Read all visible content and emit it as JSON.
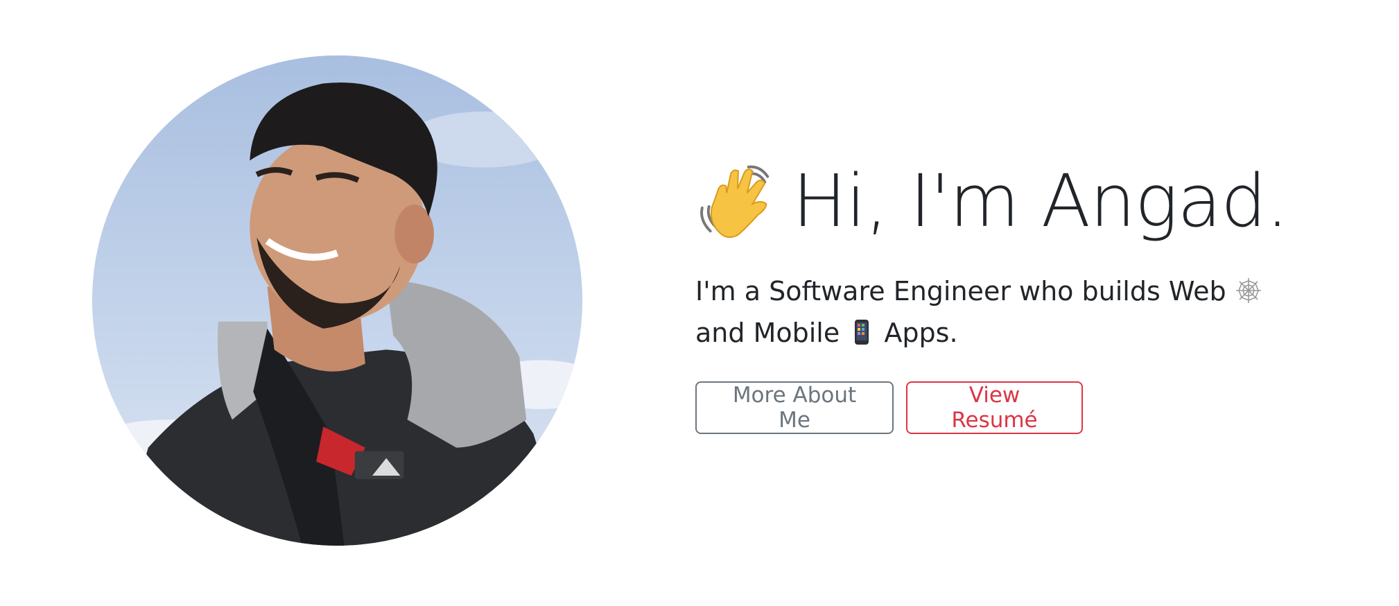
{
  "hero": {
    "profile_photo_alt": "Angad",
    "headline_icon": "waving-hand-icon",
    "headline": "Hi, I'm Angad.",
    "tagline": {
      "part1": "I'm a Software Engineer who builds Web",
      "web_icon": "spider-web-icon",
      "part2": "and Mobile",
      "mobile_icon": "mobile-phone-icon",
      "part3": "Apps."
    },
    "buttons": {
      "about_label": "More About Me",
      "resume_label": "View Resumé"
    }
  },
  "colors": {
    "text": "#212529",
    "secondary": "#6c757d",
    "danger": "#dc3545",
    "background": "#ffffff"
  }
}
